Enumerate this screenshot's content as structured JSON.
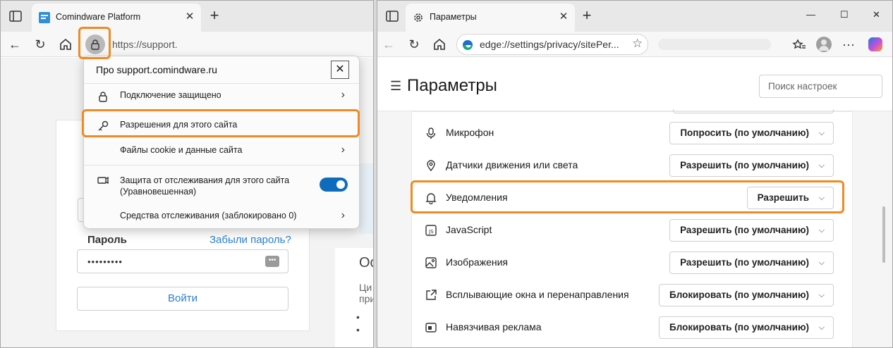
{
  "left_browser": {
    "tab": {
      "title": "Comindware Platform"
    },
    "address": {
      "url": "https://support."
    },
    "login": {
      "password_label": "Пароль",
      "forgot_link": "Забыли пароль?",
      "password_value": "•••••••••",
      "login_button": "Войти"
    },
    "side_text": {
      "heading": "Ос",
      "line1": "Ци",
      "line2": "при",
      "bullet": "•"
    },
    "site_info_popup": {
      "title": "Про support.comindware.ru",
      "rows": [
        {
          "label": "Подключение защищено"
        },
        {
          "label": "Разрешения для этого сайта"
        },
        {
          "label": "Файлы cookie и данные сайта"
        },
        {
          "label": "Защита от отслеживания для этого сайта\n(Уравновешенная)",
          "label_line1": "Защита от отслеживания для этого сайта",
          "label_line2": "(Уравновешенная)",
          "toggle": "on"
        },
        {
          "label": "Средства отслеживания (заблокировано 0)"
        }
      ]
    }
  },
  "right_browser": {
    "tab": {
      "title": "Параметры"
    },
    "address": {
      "url": "edge://settings/privacy/sitePer..."
    },
    "settings": {
      "title": "Параметры",
      "search_placeholder": "Поиск настроек",
      "permissions": [
        {
          "label": "Микрофон",
          "value": "Попросить (по умолчанию)",
          "icon": "microphone-icon"
        },
        {
          "label": "Датчики движения или света",
          "value": "Разрешить (по умолчанию)",
          "icon": "location-icon"
        },
        {
          "label": "Уведомления",
          "value": "Разрешить",
          "icon": "bell-icon"
        },
        {
          "label": "JavaScript",
          "value": "Разрешить (по умолчанию)",
          "icon": "javascript-icon"
        },
        {
          "label": "Изображения",
          "value": "Разрешить (по умолчанию)",
          "icon": "image-icon"
        },
        {
          "label": "Всплывающие окна и перенаправления",
          "value": "Блокировать (по умолчанию)",
          "icon": "popup-icon"
        },
        {
          "label": "Навязчивая реклама",
          "value": "Блокировать (по умолчанию)",
          "icon": "ad-icon"
        }
      ]
    }
  },
  "colors": {
    "highlight": "#f08a24",
    "accent": "#0f6cbd",
    "link": "#2a7fd4"
  }
}
